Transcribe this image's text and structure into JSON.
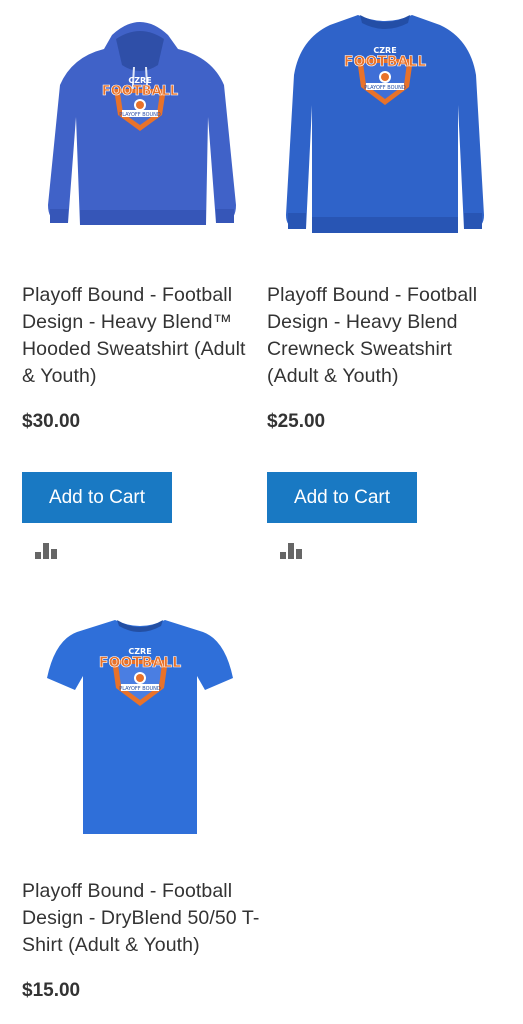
{
  "products": [
    {
      "name": "Playoff Bound - Football Design - Heavy Blend™ Hooded Sweatshirt (Adult & Youth)",
      "price": "$30.00",
      "add_to_cart": "Add to Cart",
      "image_kind": "hooded-sweatshirt"
    },
    {
      "name": "Playoff Bound - Football Design - Heavy Blend Crewneck Sweatshirt (Adult & Youth)",
      "price": "$25.00",
      "add_to_cart": "Add to Cart",
      "image_kind": "crewneck-sweatshirt"
    },
    {
      "name": "Playoff Bound - Football Design - DryBlend 50/50 T-Shirt (Adult & Youth)",
      "price": "$15.00",
      "image_kind": "t-shirt"
    }
  ],
  "graphic": {
    "top_text": "CZRE",
    "main_text": "FOOTBALL",
    "banner_text": "PLAYOFF BOUND"
  },
  "colors": {
    "accent": "#1979c3",
    "hoodie": "#4062c8",
    "crewneck": "#2f63c9",
    "tshirt": "#2f6fd9",
    "logo_orange": "#e8722a"
  },
  "icons": {
    "compare": "compare-icon"
  }
}
